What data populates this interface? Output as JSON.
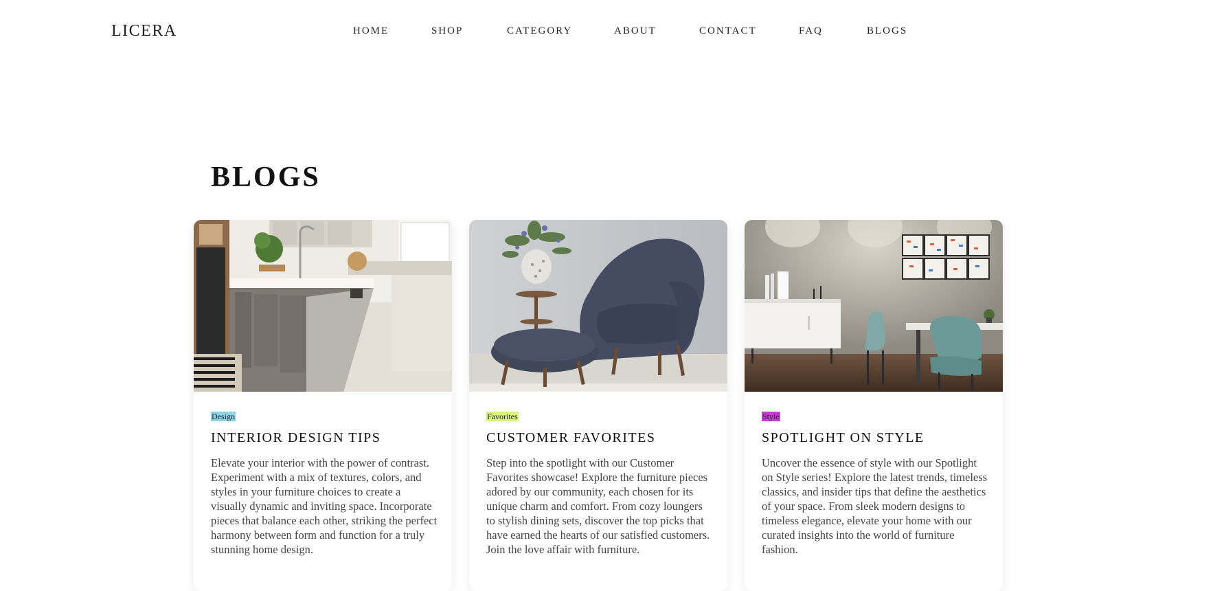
{
  "header": {
    "logo": "LICERA",
    "nav": [
      {
        "label": "HOME"
      },
      {
        "label": "SHOP"
      },
      {
        "label": "CATEGORY"
      },
      {
        "label": "ABOUT"
      },
      {
        "label": "CONTACT"
      },
      {
        "label": "FAQ"
      },
      {
        "label": "BLOGS"
      }
    ]
  },
  "blogs": {
    "title": "BLOGS",
    "cards": [
      {
        "tag": "Design",
        "tag_color": "#8fd3e8",
        "title": "INTERIOR DESIGN TIPS",
        "text": "Elevate your interior with the power of contrast. Experiment with a mix of textures, colors, and styles in your furniture choices to create a visually dynamic and inviting space. Incorporate pieces that balance each other, striking the perfect harmony between form and function for a truly stunning home design."
      },
      {
        "tag": "Favorites",
        "tag_color": "#d9f57a",
        "title": "CUSTOMER FAVORITES",
        "text": "Step into the spotlight with our Customer Favorites showcase! Explore the furniture pieces adored by our community, each chosen for its unique charm and comfort. From cozy loungers to stylish dining sets, discover the top picks that have earned the hearts of our satisfied customers. Join the love affair with furniture."
      },
      {
        "tag": "Style",
        "tag_color": "#c73bd6",
        "title": "SPOTLIGHT ON STYLE",
        "text": "Uncover the essence of style with our Spotlight on Style series! Explore the latest trends, timeless classics, and insider tips that define the aesthetics of your space. From sleek modern designs to timeless elegance, elevate your home with our curated insights into the world of furniture fashion."
      }
    ]
  }
}
